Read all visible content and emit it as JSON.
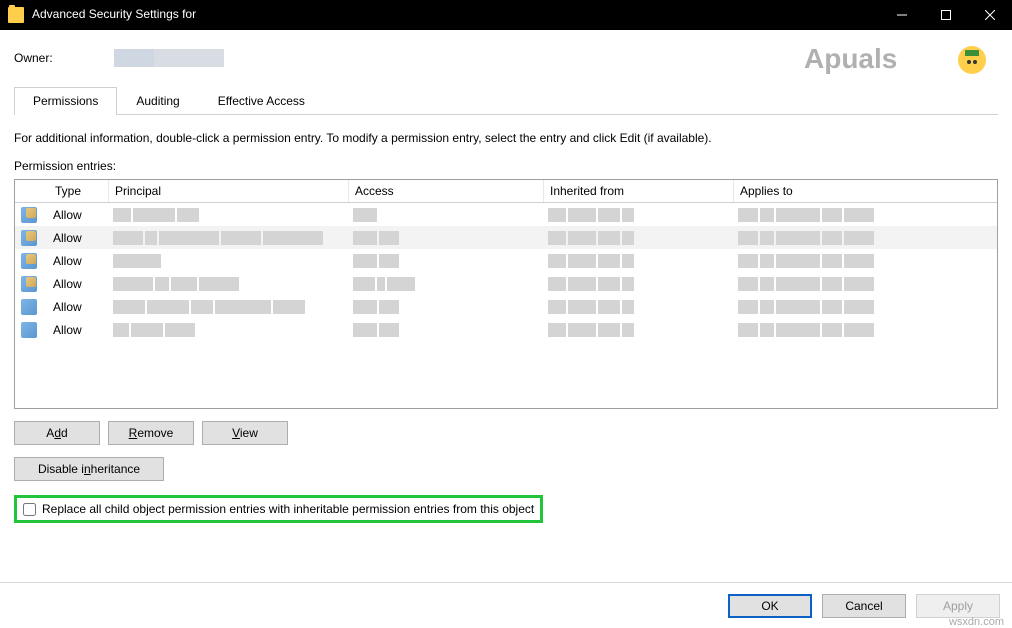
{
  "titlebar": {
    "title": "Advanced Security Settings for"
  },
  "owner": {
    "label": "Owner:"
  },
  "tabs": {
    "permissions": "Permissions",
    "auditing": "Auditing",
    "effective": "Effective Access"
  },
  "info": "For additional information, double-click a permission entry. To modify a permission entry, select the entry and click Edit (if available).",
  "entries_label": "Permission entries:",
  "grid": {
    "headers": {
      "type": "Type",
      "principal": "Principal",
      "access": "Access",
      "inherited": "Inherited from",
      "applies": "Applies to"
    },
    "rows": [
      {
        "type": "Allow"
      },
      {
        "type": "Allow"
      },
      {
        "type": "Allow"
      },
      {
        "type": "Allow"
      },
      {
        "type": "Allow"
      },
      {
        "type": "Allow"
      }
    ]
  },
  "buttons": {
    "add": "Add",
    "remove": "Remove",
    "view": "View",
    "disable_inherit": "Disable inheritance"
  },
  "replace_label": "Replace all child object permission entries with inheritable permission entries from this object",
  "footer": {
    "ok": "OK",
    "cancel": "Cancel",
    "apply": "Apply"
  },
  "watermark": "wsxdn.com",
  "logo_text": "Apuals"
}
